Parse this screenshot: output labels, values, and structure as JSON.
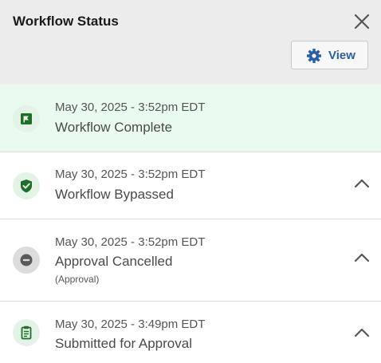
{
  "header": {
    "title": "Workflow Status",
    "close_icon": "close-icon",
    "view_button": {
      "label": "View",
      "icon": "gear-icon"
    }
  },
  "colors": {
    "header_bg": "#ececec",
    "active_item_bg": "#e9fbee",
    "icon_green": "#1f6e2a",
    "icon_green_bg": "#e3f3e5",
    "icon_gray": "#5a5a5a",
    "icon_gray_bg": "#dcdcdc",
    "button_text": "#2a5fa5"
  },
  "items": [
    {
      "timestamp": "May 30, 2025 - 3:52pm EDT",
      "title": "Workflow Complete",
      "subtitle": "",
      "icon": "flag-icon",
      "expandable": false
    },
    {
      "timestamp": "May 30, 2025 - 3:52pm EDT",
      "title": "Workflow Bypassed",
      "subtitle": "",
      "icon": "shield-check-icon",
      "expandable": true
    },
    {
      "timestamp": "May 30, 2025 - 3:52pm EDT",
      "title": "Approval Cancelled",
      "subtitle": "(Approval)",
      "icon": "minus-circle-icon",
      "expandable": true
    },
    {
      "timestamp": "May 30, 2025 - 3:49pm EDT",
      "title": "Submitted for Approval",
      "subtitle": "",
      "icon": "clipboard-icon",
      "expandable": true
    }
  ]
}
